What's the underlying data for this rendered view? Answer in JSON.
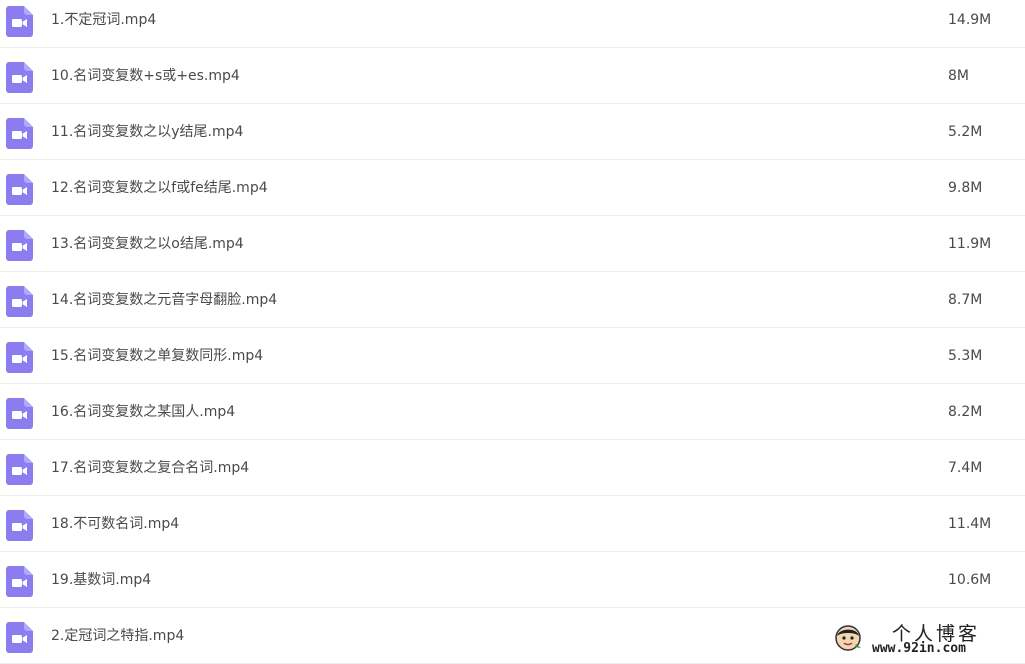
{
  "theme": {
    "icon_color": "#8b7cf0",
    "text_color": "#4a4a4a",
    "divider_color": "#ececec"
  },
  "files": [
    {
      "name": "1.不定冠词.mp4",
      "size": "14.9M",
      "icon": "video-file-icon"
    },
    {
      "name": "10.名词变复数+s或+es.mp4",
      "size": "8M",
      "icon": "video-file-icon"
    },
    {
      "name": "11.名词变复数之以y结尾.mp4",
      "size": "5.2M",
      "icon": "video-file-icon"
    },
    {
      "name": "12.名词变复数之以f或fe结尾.mp4",
      "size": "9.8M",
      "icon": "video-file-icon"
    },
    {
      "name": "13.名词变复数之以o结尾.mp4",
      "size": "11.9M",
      "icon": "video-file-icon"
    },
    {
      "name": "14.名词变复数之元音字母翻脸.mp4",
      "size": "8.7M",
      "icon": "video-file-icon"
    },
    {
      "name": "15.名词变复数之单复数同形.mp4",
      "size": "5.3M",
      "icon": "video-file-icon"
    },
    {
      "name": "16.名词变复数之某国人.mp4",
      "size": "8.2M",
      "icon": "video-file-icon"
    },
    {
      "name": "17.名词变复数之复合名词.mp4",
      "size": "7.4M",
      "icon": "video-file-icon"
    },
    {
      "name": "18.不可数名词.mp4",
      "size": "11.4M",
      "icon": "video-file-icon"
    },
    {
      "name": "19.基数词.mp4",
      "size": "10.6M",
      "icon": "video-file-icon"
    },
    {
      "name": "2.定冠词之特指.mp4",
      "size": "",
      "icon": "video-file-icon"
    }
  ],
  "watermark": {
    "title": "个人博客",
    "url": "www.92in.com",
    "icon": "mascot-icon"
  }
}
